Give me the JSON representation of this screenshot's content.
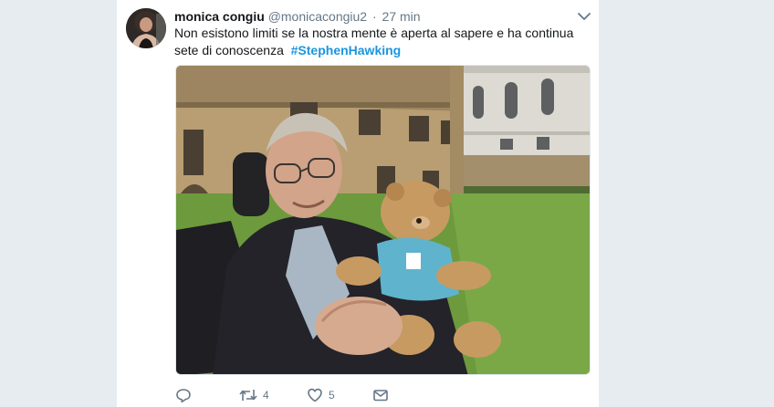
{
  "tweet": {
    "display_name": "monica congiu",
    "username": "@monicacongiu2",
    "separator": "·",
    "timestamp": "27 min",
    "text": "Non esistono limiti se la nostra mente è aperta al sapere e ha continua sete di conoscenza",
    "hashtag": "#StephenHawking"
  },
  "media": {
    "kind": "photo"
  },
  "actions": {
    "reply": {
      "icon": "reply-icon",
      "count": ""
    },
    "retweet": {
      "icon": "retweet-icon",
      "count": "4"
    },
    "like": {
      "icon": "heart-icon",
      "count": "5"
    },
    "message": {
      "icon": "envelope-icon",
      "count": ""
    }
  },
  "colors": {
    "page_bg": "#e6ecf0",
    "card_bg": "#ffffff",
    "text_primary": "#14171a",
    "text_secondary": "#657786",
    "link": "#1b95e0"
  }
}
